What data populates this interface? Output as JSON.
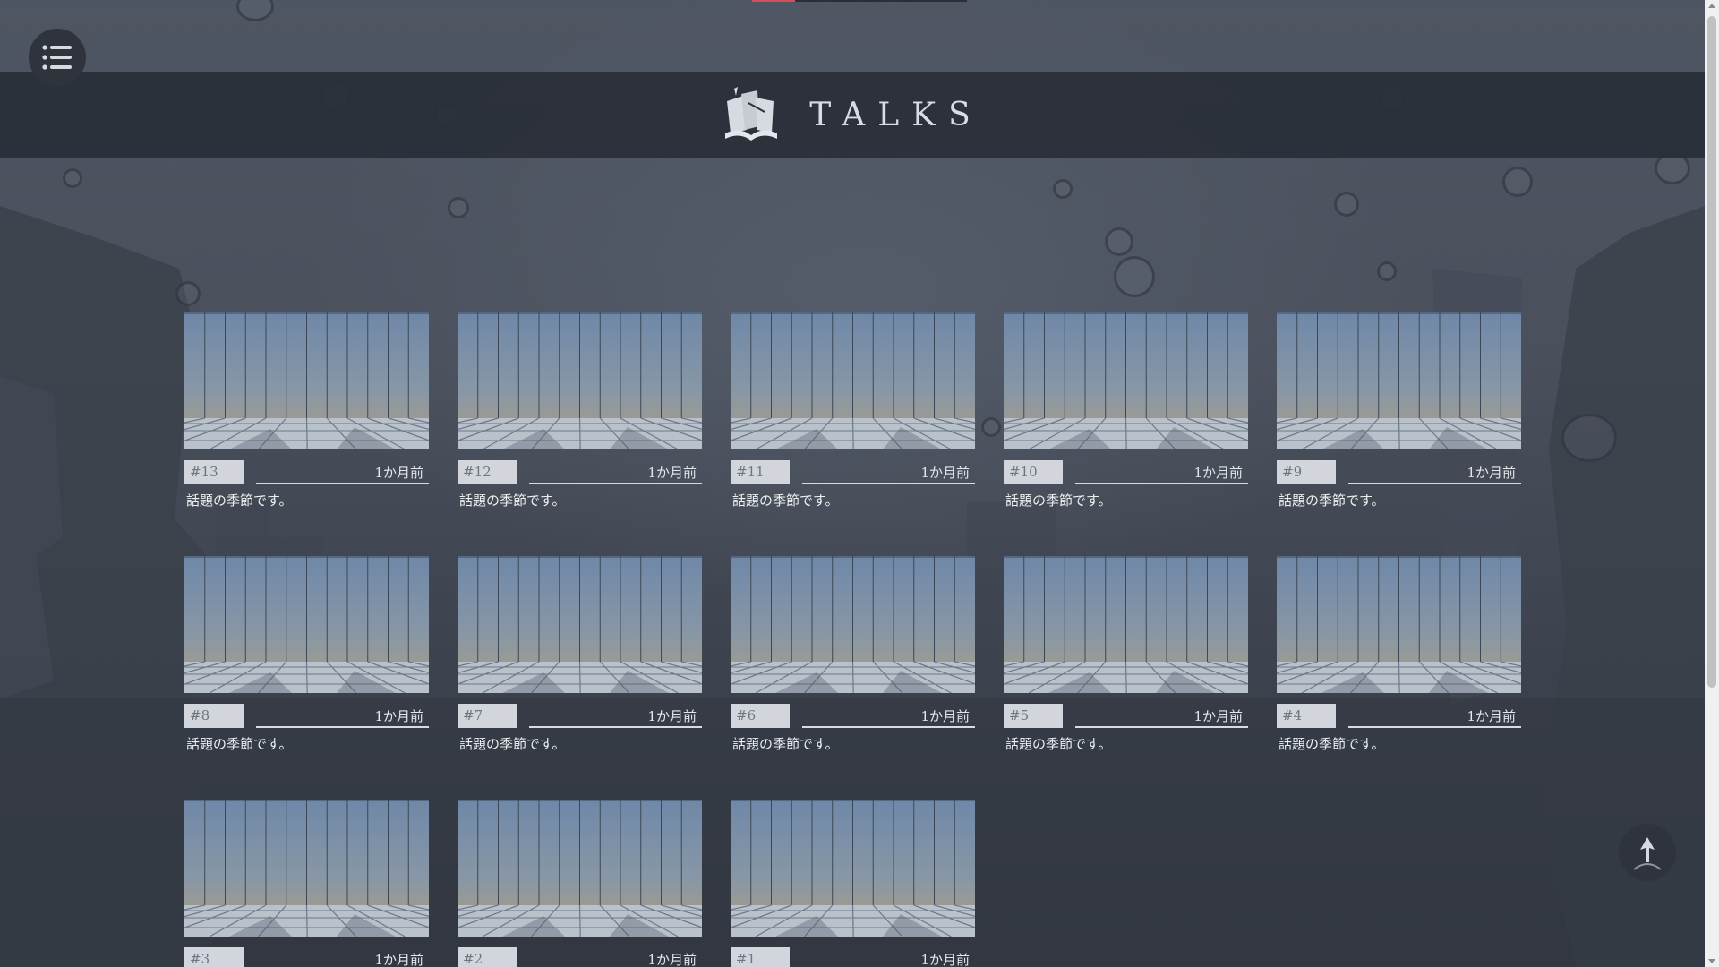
{
  "header": {
    "title": "TALKS"
  },
  "icons": {
    "menu": "list-icon",
    "logo": "books-icon",
    "scroll_top": "arrow-up-icon"
  },
  "colors": {
    "accent": "#d2505a",
    "header_band": "#2c313a",
    "badge": "#d2d6dc"
  },
  "progress": {
    "fraction": 0.2
  },
  "talks": [
    {
      "number": "#13",
      "date": "1か月前",
      "caption": "話題の季節です。"
    },
    {
      "number": "#12",
      "date": "1か月前",
      "caption": "話題の季節です。"
    },
    {
      "number": "#11",
      "date": "1か月前",
      "caption": "話題の季節です。"
    },
    {
      "number": "#10",
      "date": "1か月前",
      "caption": "話題の季節です。"
    },
    {
      "number": "#9",
      "date": "1か月前",
      "caption": "話題の季節です。"
    },
    {
      "number": "#8",
      "date": "1か月前",
      "caption": "話題の季節です。"
    },
    {
      "number": "#7",
      "date": "1か月前",
      "caption": "話題の季節です。"
    },
    {
      "number": "#6",
      "date": "1か月前",
      "caption": "話題の季節です。"
    },
    {
      "number": "#5",
      "date": "1か月前",
      "caption": "話題の季節です。"
    },
    {
      "number": "#4",
      "date": "1か月前",
      "caption": "話題の季節です。"
    },
    {
      "number": "#3",
      "date": "1か月前",
      "caption": ""
    },
    {
      "number": "#2",
      "date": "1か月前",
      "caption": ""
    },
    {
      "number": "#1",
      "date": "1か月前",
      "caption": ""
    }
  ]
}
